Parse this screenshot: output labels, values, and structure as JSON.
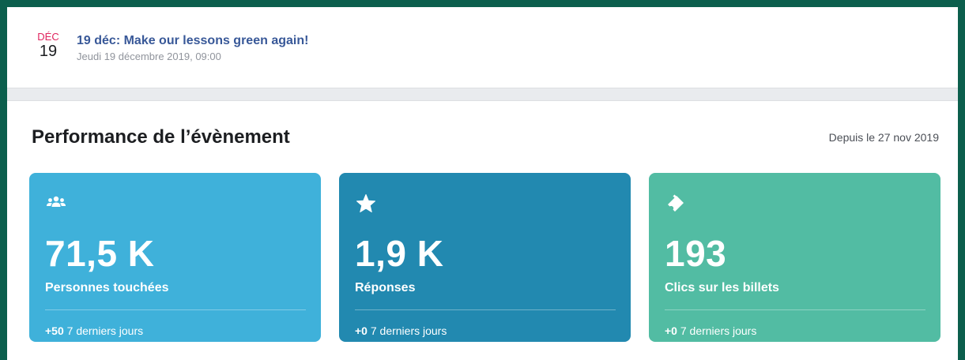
{
  "event": {
    "month": "DÉC",
    "day": "19",
    "title": "19 déc: Make our lessons green again!",
    "datetime": "Jeudi 19 décembre 2019, 09:00"
  },
  "performance": {
    "title": "Performance de l’évènement",
    "since": "Depuis le 27 nov 2019"
  },
  "cards": [
    {
      "icon": "people-icon",
      "value": "71,5 K",
      "label": "Personnes touchées",
      "delta": "+50",
      "period": "7 derniers jours",
      "color": "#3fb1da"
    },
    {
      "icon": "star-icon",
      "value": "1,9 K",
      "label": "Réponses",
      "delta": "+0",
      "period": "7 derniers jours",
      "color": "#2289b0"
    },
    {
      "icon": "ticket-icon",
      "value": "193",
      "label": "Clics sur les billets",
      "delta": "+0",
      "period": "7 derniers jours",
      "color": "#52bca3"
    }
  ],
  "colors": {
    "frame": "#0c5f4d",
    "title_link": "#385898",
    "month_red": "#e0245e"
  }
}
